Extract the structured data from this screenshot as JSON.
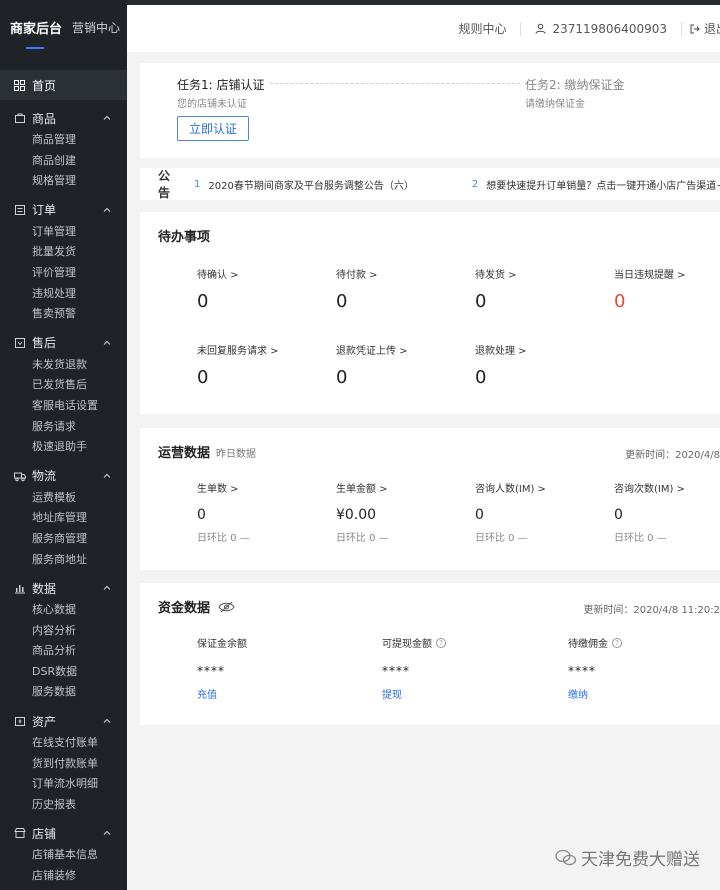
{
  "sidebar": {
    "brand_title": "商家后台",
    "brand_sub": "营销中心",
    "home": "首页",
    "groups": [
      {
        "label": "商品",
        "items": [
          "商品管理",
          "商品创建",
          "规格管理"
        ]
      },
      {
        "label": "订单",
        "items": [
          "订单管理",
          "批量发货",
          "评价管理",
          "违规处理",
          "售卖预警"
        ]
      },
      {
        "label": "售后",
        "items": [
          "未发货退款",
          "已发货售后",
          "客服电话设置",
          "服务请求",
          "极速退助手"
        ]
      },
      {
        "label": "物流",
        "items": [
          "运费模板",
          "地址库管理",
          "服务商管理",
          "服务商地址"
        ]
      },
      {
        "label": "数据",
        "items": [
          "核心数据",
          "内容分析",
          "商品分析",
          "DSR数据",
          "服务数据"
        ]
      },
      {
        "label": "资产",
        "items": [
          "在线支付账单",
          "货到付款账单",
          "订单流水明细",
          "历史报表"
        ]
      },
      {
        "label": "店铺",
        "items": [
          "店铺基本信息",
          "店铺装修"
        ]
      }
    ]
  },
  "topbar": {
    "rules": "规则中心",
    "user_id": "237119806400903",
    "logout": "退出"
  },
  "tasks": {
    "task1_title": "任务1: 店铺认证",
    "task1_sub": "您的店铺未认证",
    "task2_title": "任务2: 缴纳保证金",
    "task2_sub": "请缴纳保证金",
    "verify_button": "立即认证"
  },
  "notice": {
    "label": "公告",
    "items": [
      {
        "num": "1",
        "text": "2020春节期间商家及平台服务调整公告（六）"
      },
      {
        "num": "2",
        "text": "想要快速提升订单销量？点击一键开通小店广告渠道~"
      }
    ]
  },
  "todo": {
    "title": "待办事项",
    "items": [
      {
        "label": "待确认 >",
        "value": "0"
      },
      {
        "label": "待付款 >",
        "value": "0"
      },
      {
        "label": "待发货 >",
        "value": "0"
      },
      {
        "label": "当日违规提醒 >",
        "value": "0"
      },
      {
        "label": "未回复服务请求 >",
        "value": "0"
      },
      {
        "label": "退款凭证上传 >",
        "value": "0"
      },
      {
        "label": "退款处理 >",
        "value": "0"
      }
    ]
  },
  "ops": {
    "title": "运营数据",
    "sub": "昨日数据",
    "updated": "更新时间：2020/4/8",
    "items": [
      {
        "label": "生单数 >",
        "value": "0",
        "compare": "日环比 0 —"
      },
      {
        "label": "生单金额 >",
        "value": "¥0.00",
        "compare": "日环比 0 —"
      },
      {
        "label": "咨询人数(IM) >",
        "value": "0",
        "compare": "日环比 0 —"
      },
      {
        "label": "咨询次数(IM) >",
        "value": "0",
        "compare": "日环比 0 —"
      }
    ]
  },
  "funds": {
    "title": "资金数据",
    "updated": "更新时间：2020/4/8 11:20:2",
    "items": [
      {
        "label": "保证金余额",
        "value": "****",
        "link": "充值"
      },
      {
        "label": "可提现金额",
        "value": "****",
        "link": "提现"
      },
      {
        "label": "待缴佣金",
        "value": "****",
        "link": "缴纳"
      }
    ]
  },
  "watermark": "天津免费大赠送",
  "colors": {
    "accent": "#2a6fe0",
    "alert": "#e04b3a",
    "sidebar": "#1f2226"
  }
}
